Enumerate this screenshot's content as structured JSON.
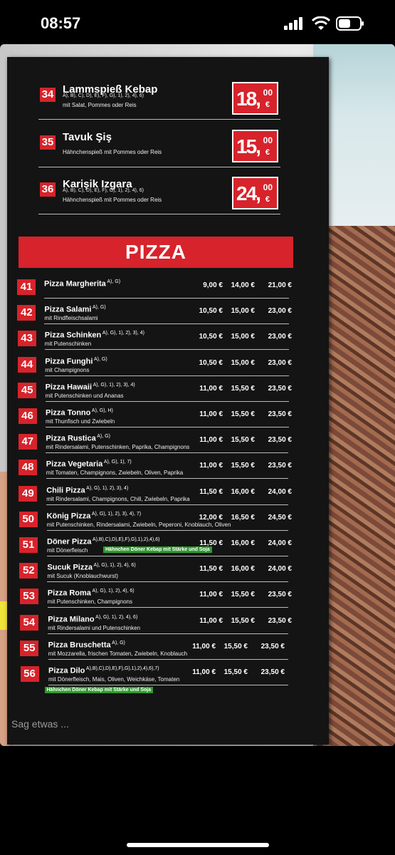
{
  "status": {
    "time": "08:57"
  },
  "top_items": [
    {
      "num": "34",
      "name": "Lammspieß Kebap",
      "allergens": "A), B), C), D), E), F), G), 1), 2), 4), 6)",
      "desc": "mit Salat, Pommes oder Reis",
      "price_big": "18,",
      "price_small": "00",
      "currency": "€"
    },
    {
      "num": "35",
      "name": "Tavuk Şiş",
      "allergens": "",
      "desc": "Hähnchenspieß mit Pommes oder Reis",
      "price_big": "15,",
      "price_small": "00",
      "currency": "€"
    },
    {
      "num": "36",
      "name": "Karişik Izgara",
      "allergens": "A), B), C), D), E), F), G), 1), 2), 4), 6)",
      "desc": "Hähnchenspieß mit Pommes oder Reis",
      "price_big": "24,",
      "price_small": "00",
      "currency": "€"
    }
  ],
  "pizza_heading": "PIZZA",
  "pizzas": [
    {
      "num": "41",
      "name": "Pizza Margherita",
      "allergens": "A), G)",
      "desc": "",
      "prices": [
        "9,00 €",
        "14,00 €",
        "21,00 €"
      ],
      "tag": ""
    },
    {
      "num": "42",
      "name": "Pizza Salami",
      "allergens": "A), G)",
      "desc": "mit Rindfleischsalami",
      "prices": [
        "10,50 €",
        "15,00 €",
        "23,00 €"
      ],
      "tag": ""
    },
    {
      "num": "43",
      "name": "Pizza Schinken",
      "allergens": "A), G), 1), 2), 3), 4)",
      "desc": "mit Putenschinken",
      "prices": [
        "10,50 €",
        "15,00 €",
        "23,00 €"
      ],
      "tag": ""
    },
    {
      "num": "44",
      "name": "Pizza Funghi",
      "allergens": "A), G)",
      "desc": "mit Champignons",
      "prices": [
        "10,50 €",
        "15,00 €",
        "23,00 €"
      ],
      "tag": ""
    },
    {
      "num": "45",
      "name": "Pizza Hawaii",
      "allergens": "A), G), 1), 2), 3), 4)",
      "desc": "mit Putenschinken und Ananas",
      "prices": [
        "11,00 €",
        "15,50 €",
        "23,50 €"
      ],
      "tag": ""
    },
    {
      "num": "46",
      "name": "Pizza Tonno",
      "allergens": "A), G), H)",
      "desc": "mit Thunfisch und Zwiebeln",
      "prices": [
        "11,00 €",
        "15,50 €",
        "23,50 €"
      ],
      "tag": ""
    },
    {
      "num": "47",
      "name": "Pizza Rustica",
      "allergens": "A), G)",
      "desc": "mit Rindersalami, Putenschinken, Paprika, Champignons",
      "prices": [
        "11,00 €",
        "15,50 €",
        "23,50 €"
      ],
      "tag": ""
    },
    {
      "num": "48",
      "name": "Pizza Vegetaria",
      "allergens": "A), G), 1), 7)",
      "desc": "mit Tomaten, Champignons, Zwiebeln, Oliven, Paprika",
      "prices": [
        "11,00 €",
        "15,50 €",
        "23,50 €"
      ],
      "tag": ""
    },
    {
      "num": "49",
      "name": "Chili Pizza",
      "allergens": "A), G), 1), 2), 3), 4)",
      "desc": "mit Rindersalami, Champignons, Chili, Zwiebeln, Paprika",
      "prices": [
        "11,50 €",
        "16,00 €",
        "24,00 €"
      ],
      "tag": ""
    },
    {
      "num": "50",
      "name": "König Pizza",
      "allergens": "A), G), 1), 2), 3), 4), 7)",
      "desc": "mit Putenschinken, Rindersalami, Zwiebeln, Peperoni, Knoblauch, Oliven",
      "prices": [
        "12,00 €",
        "16,50 €",
        "24,50 €"
      ],
      "tag": ""
    },
    {
      "num": "51",
      "name": "Döner Pizza",
      "allergens": "A),B),C),D),E),F),G),1),2),4),6)",
      "desc": "mit Dönerfleisch",
      "prices": [
        "11,50 €",
        "16,00 €",
        "24,00 €"
      ],
      "tag": "Hähnchen Döner Kebap mit Stärke und Soja"
    },
    {
      "num": "52",
      "name": "Sucuk Pizza",
      "allergens": "A), G), 1), 2), 4), 6)",
      "desc": "mit Sucuk (Knoblauchwurst)",
      "prices": [
        "11,50 €",
        "16,00 €",
        "24,00 €"
      ],
      "tag": ""
    },
    {
      "num": "53",
      "name": "Pizza Roma",
      "allergens": "A), G), 1), 2), 4), 6)",
      "desc": "mit Putenschinken, Champignons",
      "prices": [
        "11,00 €",
        "15,50 €",
        "23,50 €"
      ],
      "tag": ""
    },
    {
      "num": "54",
      "name": "Pizza Milano",
      "allergens": "A), G), 1), 2), 4), 6)",
      "desc": "mit Rindersalami und Putenschinken",
      "prices": [
        "11,00 €",
        "15,50 €",
        "23,50 €"
      ],
      "tag": ""
    },
    {
      "num": "55",
      "name": "Pizza Bruschetta",
      "allergens": "A), G)",
      "desc": "mit Mozzarella, frischen Tomaten, Zwiebeln, Knoblauch",
      "prices": [
        "11,00 €",
        "15,50 €",
        "23,50 €"
      ],
      "tag": ""
    },
    {
      "num": "56",
      "name": "Pizza Dilo",
      "allergens": "A),B),C),D),E),F),G),1),2),4),6),7)",
      "desc": "mit Dönerfleisch, Mais, Oliven, Weichkäse, Tomaten",
      "prices": [
        "11,00 €",
        "15,50 €",
        "23,50 €"
      ],
      "tag": "Hähnchen Döner Kebap mit Stärke und Soja"
    }
  ],
  "comment_placeholder": "Sag etwas ...",
  "colors": {
    "accent_red": "#d7232b",
    "menu_bg": "#141414",
    "tag_green": "#2e9a2e"
  }
}
